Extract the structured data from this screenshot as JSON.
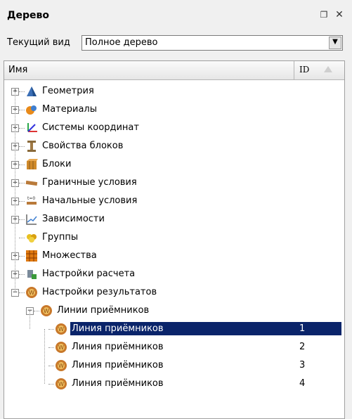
{
  "panel": {
    "title": "Дерево"
  },
  "view": {
    "label": "Текущий вид",
    "selected": "Полное дерево"
  },
  "columns": {
    "name": "Имя",
    "id": "ID"
  },
  "tree": [
    {
      "label": "Геометрия",
      "icon": "geometry-icon"
    },
    {
      "label": "Материалы",
      "icon": "materials-icon"
    },
    {
      "label": "Системы координат",
      "icon": "coordinate-systems-icon"
    },
    {
      "label": "Свойства блоков",
      "icon": "block-properties-icon"
    },
    {
      "label": "Блоки",
      "icon": "blocks-icon"
    },
    {
      "label": "Граничные условия",
      "icon": "boundary-conditions-icon"
    },
    {
      "label": "Начальные условия",
      "icon": "initial-conditions-icon",
      "icon_text": "t=0"
    },
    {
      "label": "Зависимости",
      "icon": "dependencies-icon"
    },
    {
      "label": "Группы",
      "icon": "groups-icon"
    },
    {
      "label": "Множества",
      "icon": "sets-icon"
    },
    {
      "label": "Настройки расчета",
      "icon": "calc-settings-icon"
    },
    {
      "label": "Настройки результатов",
      "icon": "results-settings-icon"
    },
    {
      "label": "Линии приёмников",
      "icon": "receiver-lines-icon"
    },
    {
      "label": "Линия приёмников",
      "id": "1",
      "icon": "receiver-line-icon"
    },
    {
      "label": "Линия приёмников",
      "id": "2",
      "icon": "receiver-line-icon"
    },
    {
      "label": "Линия приёмников",
      "id": "3",
      "icon": "receiver-line-icon"
    },
    {
      "label": "Линия приёмников",
      "id": "4",
      "icon": "receiver-line-icon"
    }
  ],
  "colors": {
    "selection": "#0a246a",
    "receiver": "#c8782a"
  }
}
